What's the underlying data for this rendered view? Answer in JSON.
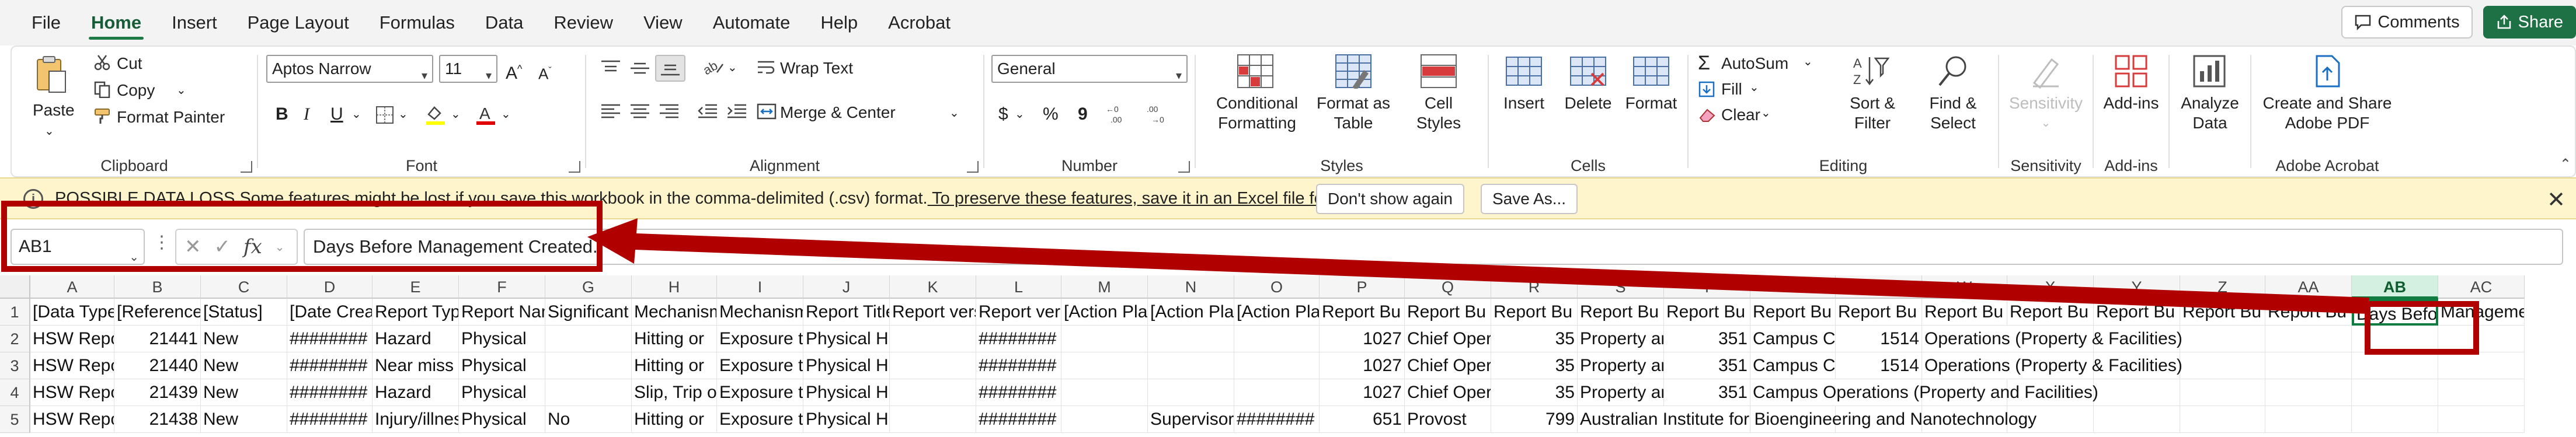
{
  "menu": {
    "tabs": [
      "File",
      "Home",
      "Insert",
      "Page Layout",
      "Formulas",
      "Data",
      "Review",
      "View",
      "Automate",
      "Help",
      "Acrobat"
    ],
    "active": "Home",
    "comments_label": "Comments",
    "share_label": "Share"
  },
  "ribbon": {
    "clipboard": {
      "label": "Clipboard",
      "paste": "Paste",
      "cut": "Cut",
      "copy": "Copy",
      "format_painter": "Format Painter"
    },
    "font": {
      "label": "Font",
      "font_name": "Aptos Narrow",
      "font_size": "11",
      "bold": "B",
      "italic": "I",
      "underline": "U",
      "grow": "A",
      "shrink": "A"
    },
    "alignment": {
      "label": "Alignment",
      "wrap_text": "Wrap Text",
      "merge_center": "Merge & Center"
    },
    "number": {
      "label": "Number",
      "format": "General",
      "currency": "$",
      "percent": "%",
      "comma": "9"
    },
    "styles": {
      "label": "Styles",
      "conditional": "Conditional",
      "conditional2": "Formatting",
      "format_as": "Format as",
      "format_as2": "Table",
      "cell": "Cell",
      "cell2": "Styles"
    },
    "cells": {
      "label": "Cells",
      "insert": "Insert",
      "delete": "Delete",
      "format": "Format"
    },
    "editing": {
      "label": "Editing",
      "autosum": "AutoSum",
      "fill": "Fill",
      "clear": "Clear",
      "sort": "Sort &",
      "sort2": "Filter",
      "find": "Find &",
      "find2": "Select"
    },
    "sensitivity": {
      "label": "Sensitivity",
      "button": "Sensitivity"
    },
    "addins": {
      "label": "Add-ins",
      "button": "Add-ins"
    },
    "analyze": {
      "button": "Analyze",
      "button2": "Data"
    },
    "acrobat": {
      "label": "Adobe Acrobat",
      "button": "Create and Share",
      "button2": "Adobe PDF"
    }
  },
  "infobar": {
    "message_prefix": "POSSIBLE DATA LOSS  Some features might be lost if you save this workbook in the comma-delimited (.csv) format.",
    "message_link": " To preserve these features, save it in an Excel file format.",
    "dont_show": "Don't show again",
    "save_as": "Save As..."
  },
  "formula_bar": {
    "name_box": "AB1",
    "fx": "fx",
    "value": "Days Before Management Created."
  },
  "grid": {
    "columns": [
      "A",
      "B",
      "C",
      "D",
      "E",
      "F",
      "G",
      "H",
      "I",
      "J",
      "K",
      "L",
      "M",
      "N",
      "O",
      "P",
      "Q",
      "R",
      "S",
      "T",
      "U",
      "V",
      "W",
      "X",
      "Y",
      "Z",
      "AA",
      "AB",
      "AC"
    ],
    "selected_column": "AB",
    "rows": [
      "1",
      "2",
      "3",
      "4",
      "5"
    ],
    "cells": {
      "r1": [
        "[Data Type]",
        "[Reference]",
        "[Status]",
        "[Date Created]",
        "Report Type",
        "Report Name",
        "Significant",
        "Mechanism",
        "Mechanism",
        "Report Title",
        "Report version",
        "Report version",
        "[Action Plan]",
        "[Action Plan]",
        "[Action Plan]",
        "Report Bu",
        "Report Bu",
        "Report Bu",
        "Report Bu",
        "Report Bu",
        "Report Bu",
        "Report Bu",
        "Report Bu",
        "Report Bu",
        "Report Bu",
        "Report Bu",
        "Report Bu",
        "Days Before Management Created.",
        "Management"
      ],
      "r2": [
        "HSW Report",
        "21441",
        "New",
        "########",
        "Hazard",
        "Physical",
        "",
        "Hitting or",
        "Exposure to",
        "Physical Hazard",
        "",
        "########",
        "",
        "",
        "",
        "1027",
        "Chief Operating",
        "35",
        "Property and",
        "351",
        "Campus C",
        "1514",
        "Operations (Property & Facilities)",
        "",
        "",
        "",
        "",
        "",
        ""
      ],
      "r3": [
        "HSW Report",
        "21440",
        "New",
        "########",
        "Near miss",
        "Physical",
        "",
        "Hitting or",
        "Exposure to",
        "Physical Hazard",
        "",
        "########",
        "",
        "",
        "",
        "1027",
        "Chief Operating",
        "35",
        "Property and",
        "351",
        "Campus C",
        "1514",
        "Operations (Property & Facilities)",
        "",
        "",
        "",
        "",
        "",
        ""
      ],
      "r4": [
        "HSW Report",
        "21439",
        "New",
        "########",
        "Hazard",
        "Physical",
        "",
        "Slip, Trip or",
        "Exposure to",
        "Physical Hazard",
        "",
        "########",
        "",
        "",
        "",
        "1027",
        "Chief Operating",
        "35",
        "Property and",
        "351",
        "Campus Operations (Property and Facilities)",
        "",
        "",
        "",
        "",
        "",
        "",
        "",
        ""
      ],
      "r5": [
        "HSW Report",
        "21438",
        "New",
        "########",
        "Injury/illness",
        "Physical",
        "No",
        "Hitting or",
        "Exposure to",
        "Physical Hazard/Injury",
        "",
        "########",
        "",
        "Supervisor",
        "########",
        "651",
        "Provost",
        "799",
        "Australian Institute for Bioengineering and Nanotechnology",
        "",
        "",
        "",
        "",
        "",
        "",
        "",
        "",
        "",
        ""
      ]
    }
  },
  "colors": {
    "accent": "#107c41",
    "annotation": "#b00000",
    "infobar": "#fff5cc"
  }
}
